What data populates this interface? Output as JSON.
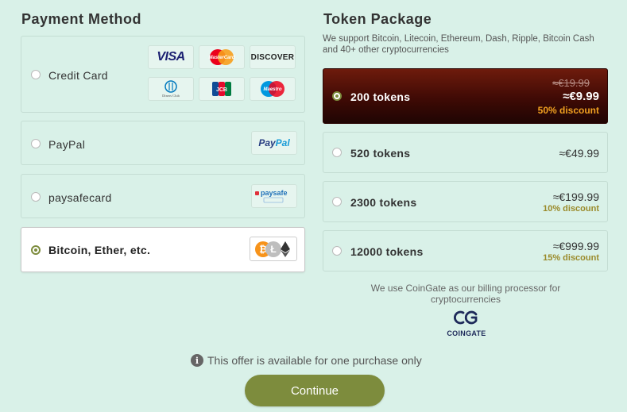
{
  "payment": {
    "title": "Payment Method",
    "methods": [
      {
        "label": "Credit Card",
        "selected": false
      },
      {
        "label": "PayPal",
        "selected": false
      },
      {
        "label": "paysafecard",
        "selected": false
      },
      {
        "label": "Bitcoin, Ether, etc.",
        "selected": true
      }
    ],
    "logos": {
      "visa": "VISA",
      "mastercard": "MasterCard",
      "discover": "DISCOVER",
      "diners": "Diners Club",
      "jcb": "JCB",
      "maestro": "Maestro",
      "paypal_a": "Pay",
      "paypal_b": "Pal",
      "paysafe": "paysafe"
    }
  },
  "tokens": {
    "title": "Token Package",
    "description": "We support Bitcoin, Litecoin, Ethereum, Dash, Ripple, Bitcoin Cash and 40+ other cryptocurrencies",
    "packages": [
      {
        "name": "200 tokens",
        "old_price": "≈€19.99",
        "price": "≈€9.99",
        "discount": "50% discount",
        "selected": true
      },
      {
        "name": "520 tokens",
        "price": "≈€49.99",
        "selected": false
      },
      {
        "name": "2300 tokens",
        "price": "≈€199.99",
        "discount": "10% discount",
        "selected": false
      },
      {
        "name": "12000 tokens",
        "price": "≈€999.99",
        "discount": "15% discount",
        "selected": false
      }
    ]
  },
  "coingate": {
    "text": "We use CoinGate as our billing processor for cryptocurrencies",
    "wordmark": "COINGATE"
  },
  "footer": {
    "offer_text": "This offer is available for one purchase only",
    "continue_label": "Continue"
  },
  "colors": {
    "background": "#d9f1e8",
    "accent": "#7d8c3d",
    "selected_package": "#4a0d06",
    "discount": "#9a8a2a"
  }
}
